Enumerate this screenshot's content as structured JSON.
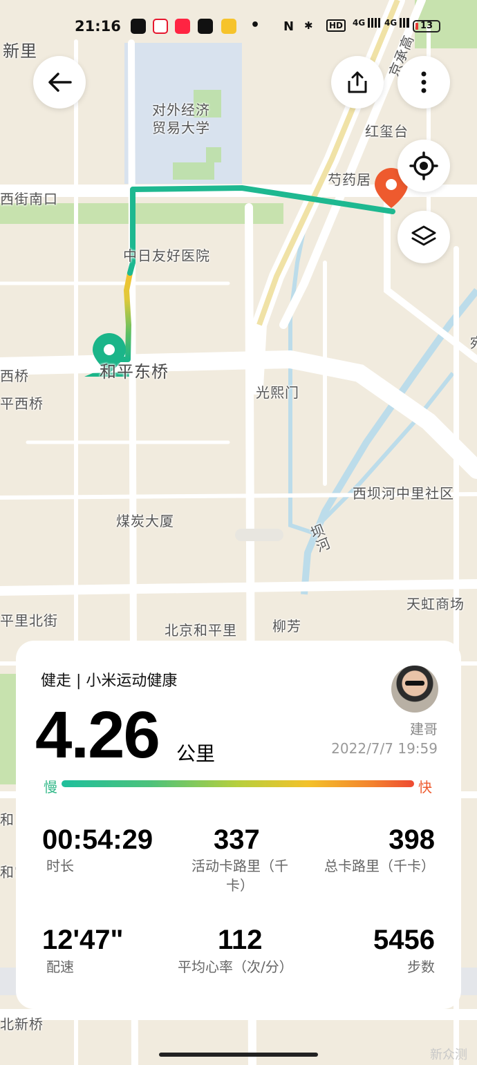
{
  "status_bar": {
    "time": "21:16",
    "apps": [
      "微博",
      "小红书",
      "抖音"
    ],
    "indicators": [
      "N",
      "HD",
      "4G",
      "4G"
    ],
    "battery": "13"
  },
  "map": {
    "labels": {
      "xinli": "新里",
      "university": "对外经济\n贸易大学",
      "hongxitai": "红玺台",
      "shaoyaoju": "芍药居",
      "jingcheng": "京承高",
      "xijienankou": "西街南口",
      "zhongri": "中日友好医院",
      "hepingdongqiao": "和平东桥",
      "xiqiao": "西桥",
      "pingxiqiao": "平西桥",
      "guangximen": "光熙门",
      "xibahe": "西坝河中里社区",
      "meitan": "煤炭大厦",
      "bahe": "坝河",
      "tianhong": "天虹商场",
      "pinglibeijie": "平里北街",
      "hepingli": "北京和平里",
      "liufang": "柳芳",
      "he": "和",
      "gong": "和宫",
      "beixin": "北新桥",
      "yuan": "宛"
    }
  },
  "buttons": {
    "back_icon": "arrow-left-icon",
    "share_icon": "share-icon",
    "more_icon": "more-vertical-icon",
    "locate_icon": "locate-icon",
    "layers_icon": "layers-icon"
  },
  "card": {
    "title": "健走 | 小米运动健康",
    "distance": "4.26",
    "distance_unit": "公里",
    "user_name": "建哥",
    "datetime": "2022/7/7 19:59",
    "legend_slow": "慢",
    "legend_fast": "快",
    "stats": [
      {
        "value": "00:54:29",
        "label": "时长"
      },
      {
        "value": "337",
        "label": "活动卡路里（千卡）"
      },
      {
        "value": "398",
        "label": "总卡路里（千卡）"
      },
      {
        "value": "12'47\"",
        "label": "配速"
      },
      {
        "value": "112",
        "label": "平均心率（次/分）"
      },
      {
        "value": "5456",
        "label": "步数"
      }
    ]
  },
  "watermark": "新众测",
  "colors": {
    "route_start": "#1bb589",
    "route_end": "#ee5a2e",
    "accent_green": "#20b57f",
    "accent_orange": "#ef5a2c"
  }
}
